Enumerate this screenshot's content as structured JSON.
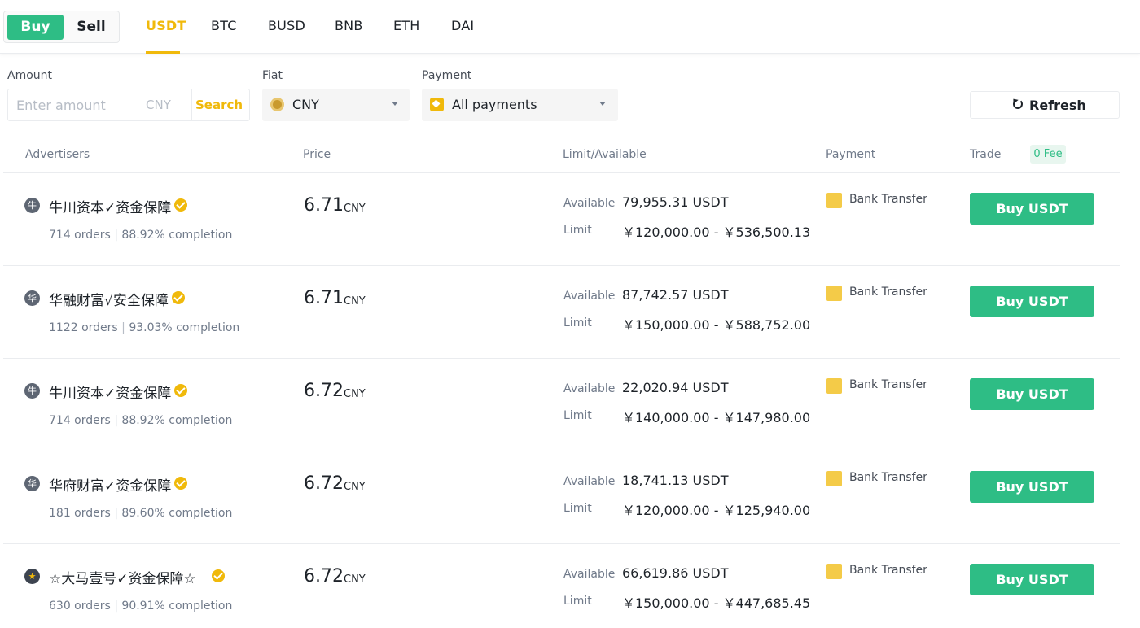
{
  "trade_mode": {
    "buy_label": "Buy",
    "sell_label": "Sell"
  },
  "asset_tabs": [
    "USDT",
    "BTC",
    "BUSD",
    "BNB",
    "ETH",
    "DAI"
  ],
  "active_asset": "USDT",
  "filters": {
    "amount_label": "Amount",
    "amount_placeholder": "Enter amount",
    "amount_unit": "CNY",
    "search_label": "Search",
    "fiat_label": "Fiat",
    "fiat_value": "CNY",
    "payment_label": "Payment",
    "payment_value": "All payments",
    "refresh_label": "Refresh"
  },
  "table_header": {
    "advertisers": "Advertisers",
    "price": "Price",
    "limit_available": "Limit/Available",
    "payment": "Payment",
    "trade": "Trade",
    "fee_badge": "0 Fee"
  },
  "labels": {
    "available": "Available",
    "limit": "Limit",
    "price_unit": "CNY",
    "buy_button": "Buy USDT"
  },
  "rows": [
    {
      "avatar": "牛",
      "name": "牛川资本✓资金保障",
      "orders": "714 orders",
      "completion": "88.92% completion",
      "price": "6.71",
      "available": "79,955.31 USDT",
      "limit": "￥120,000.00 - ￥536,500.13",
      "payment": "Bank Transfer"
    },
    {
      "avatar": "华",
      "name": "华融财富√安全保障",
      "orders": "1122 orders",
      "completion": "93.03% completion",
      "price": "6.71",
      "available": "87,742.57 USDT",
      "limit": "￥150,000.00 - ￥588,752.00",
      "payment": "Bank Transfer"
    },
    {
      "avatar": "牛",
      "name": "牛川资本✓资金保障",
      "orders": "714 orders",
      "completion": "88.92% completion",
      "price": "6.72",
      "available": "22,020.94 USDT",
      "limit": "￥140,000.00 - ￥147,980.00",
      "payment": "Bank Transfer"
    },
    {
      "avatar": "华",
      "name": "华府财富✓资金保障",
      "orders": "181 orders",
      "completion": "89.60% completion",
      "price": "6.72",
      "available": "18,741.13 USDT",
      "limit": "￥120,000.00 - ￥125,940.00",
      "payment": "Bank Transfer"
    },
    {
      "avatar": "★",
      "name": "☆大马壹号✓资金保障☆",
      "orders": "630 orders",
      "completion": "90.91% completion",
      "price": "6.72",
      "available": "66,619.86 USDT",
      "limit": "￥150,000.00 - ￥447,685.45",
      "payment": "Bank Transfer"
    }
  ],
  "colors": {
    "buy_green": "#2ebd85",
    "accent_yellow": "#f0b90b"
  }
}
